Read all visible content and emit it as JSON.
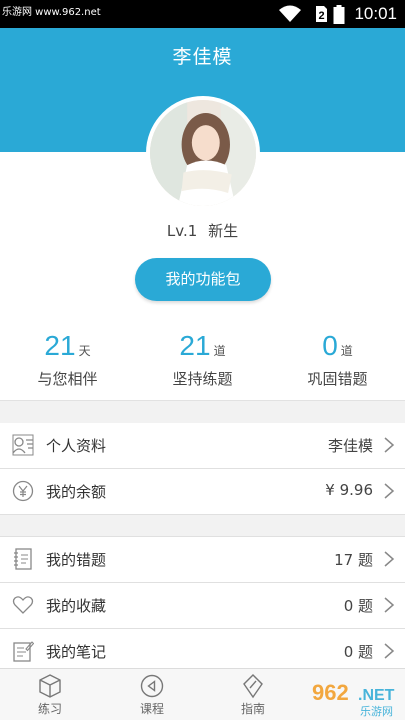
{
  "status_bar": {
    "watermark": "乐游网 www.962.net",
    "time": "10:01",
    "battery_text": "2"
  },
  "header": {
    "title": "李佳模"
  },
  "profile": {
    "level": "Lv.1",
    "rank": "新生",
    "pack_button": "我的功能包"
  },
  "stats": [
    {
      "value": "21",
      "unit": "天",
      "label": "与您相伴"
    },
    {
      "value": "21",
      "unit": "道",
      "label": "坚持练题"
    },
    {
      "value": "0",
      "unit": "道",
      "label": "巩固错题"
    }
  ],
  "account": [
    {
      "icon": "id-card-icon",
      "label": "个人资料",
      "value": "李佳模"
    },
    {
      "icon": "yen-coin-icon",
      "label": "我的余额",
      "value": "¥ 9.96"
    }
  ],
  "study": [
    {
      "icon": "notebook-icon",
      "label": "我的错题",
      "value": "17 题"
    },
    {
      "icon": "heart-icon",
      "label": "我的收藏",
      "value": "0 题"
    },
    {
      "icon": "note-icon",
      "label": "我的笔记",
      "value": "0 题"
    }
  ],
  "tabs": [
    {
      "icon": "cube-icon",
      "label": "练习"
    },
    {
      "icon": "play-circle-icon",
      "label": "课程"
    },
    {
      "icon": "compass-icon",
      "label": "指南"
    }
  ],
  "watermark_logo": "962.NET 乐游网",
  "colors": {
    "accent": "#2aa9d6",
    "background": "#f2f2f2"
  }
}
